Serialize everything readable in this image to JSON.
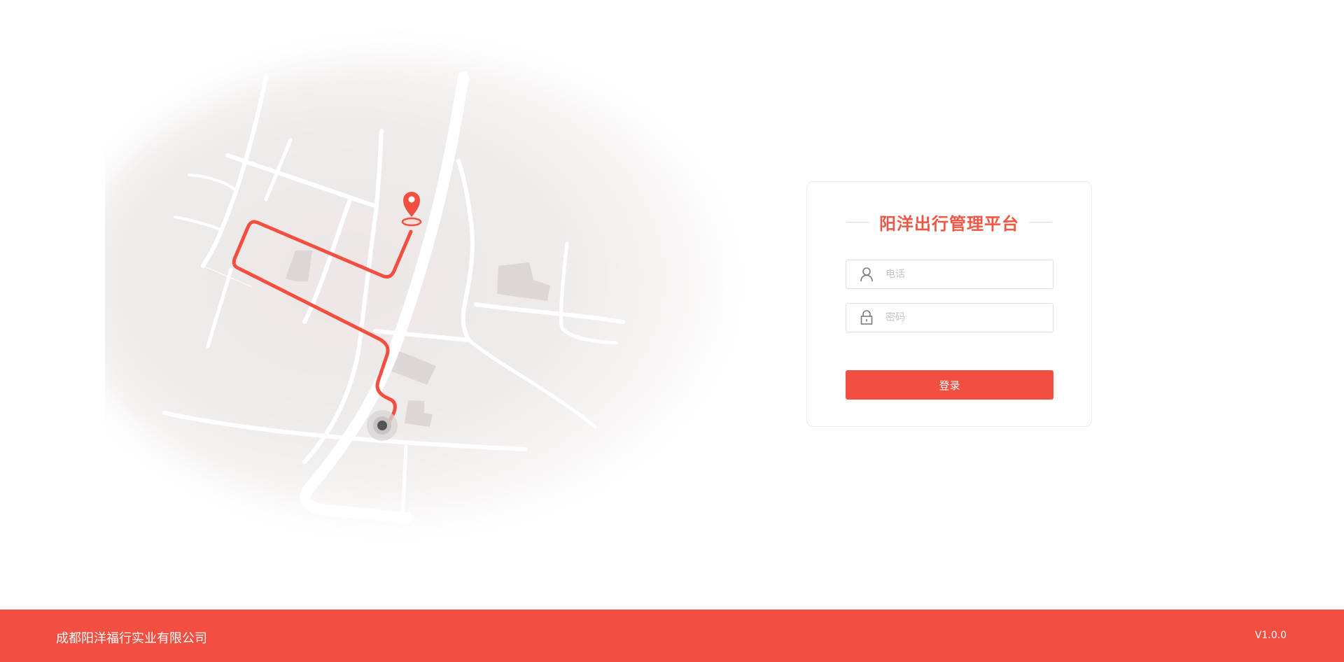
{
  "login": {
    "title": "阳洋出行管理平台",
    "phone_placeholder": "电话",
    "password_placeholder": "密码",
    "submit_label": "登录",
    "user_icon": "user-icon",
    "lock_icon": "lock-icon"
  },
  "footer": {
    "company": "成都阳洋福行实业有限公司",
    "version": "V1.0.0"
  },
  "colors": {
    "accent": "#f24f40",
    "title": "#f15644",
    "route": "#f24f40"
  },
  "illustration": {
    "icons": [
      "map-pin-icon",
      "origin-dot-icon"
    ]
  }
}
